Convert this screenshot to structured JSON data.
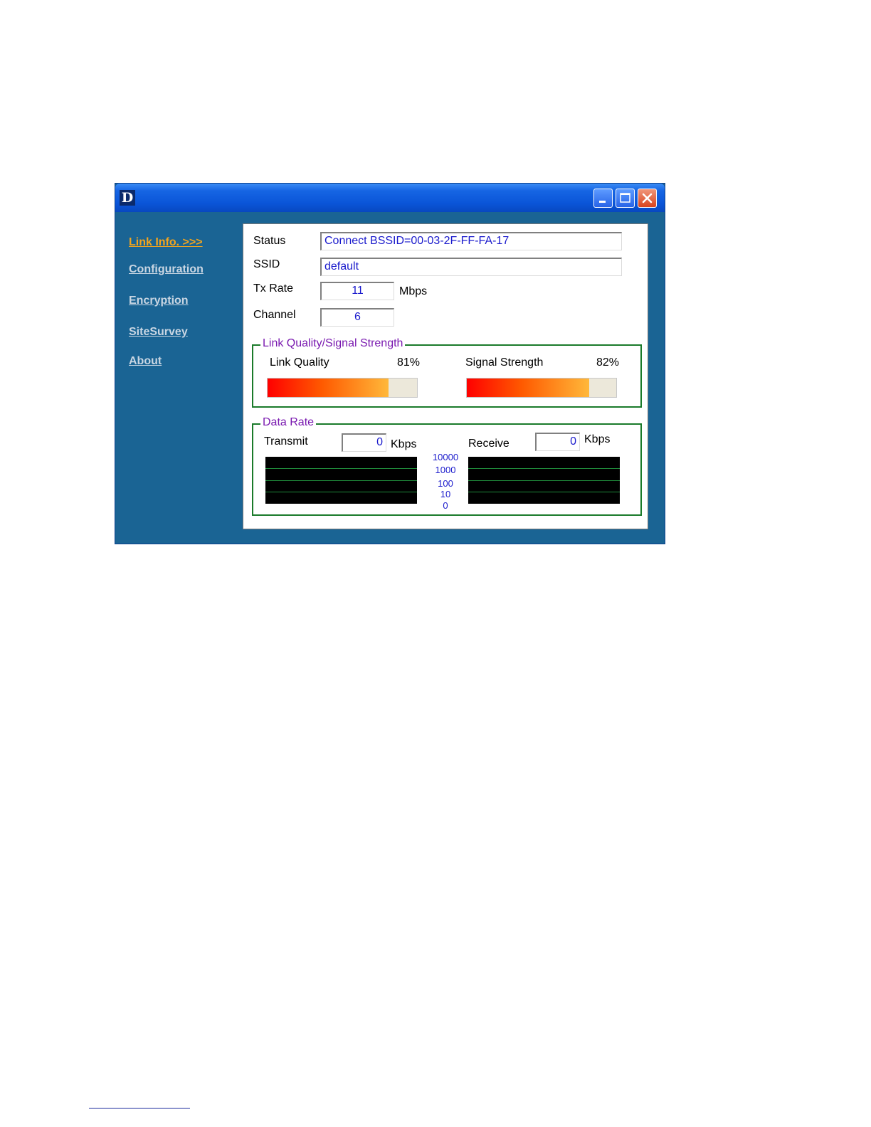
{
  "window": {
    "logo_letter": "D",
    "controls": {
      "minimize": "minimize-icon",
      "maximize": "maximize-icon",
      "close": "close-icon"
    }
  },
  "sidebar": {
    "items": [
      {
        "label": "Link Info. >>>",
        "active": true
      },
      {
        "label": "Configuration",
        "active": false
      },
      {
        "label": "Encryption",
        "active": false
      },
      {
        "label": "SiteSurvey",
        "active": false
      },
      {
        "label": "About",
        "active": false
      }
    ]
  },
  "link_info": {
    "status_label": "Status",
    "status_value": "Connect BSSID=00-03-2F-FF-FA-17",
    "ssid_label": "SSID",
    "ssid_value": "default",
    "txrate_label": "Tx Rate",
    "txrate_value": "11",
    "txrate_unit": "Mbps",
    "channel_label": "Channel",
    "channel_value": "6"
  },
  "signal": {
    "group_title": "Link Quality/Signal Strength",
    "link_quality_label": "Link Quality",
    "link_quality_text": "81%",
    "link_quality_level": 0.81,
    "signal_strength_label": "Signal Strength",
    "signal_strength_text": "82%",
    "signal_strength_level": 0.82
  },
  "data_rate": {
    "group_title": "Data Rate",
    "transmit_label": "Transmit",
    "transmit_value": "0",
    "transmit_unit": "Kbps",
    "receive_label": "Receive",
    "receive_value": "0",
    "receive_unit": "Kbps",
    "scale": [
      "10000",
      "1000",
      "100",
      "10",
      "0"
    ]
  },
  "colors": {
    "window_bg": "#1a6494",
    "active_link": "#f2a51e",
    "inactive_link": "#c9d6e3",
    "group_border": "#1a7a2a",
    "group_title": "#7a1ab0",
    "value_text": "#1a1acc"
  }
}
